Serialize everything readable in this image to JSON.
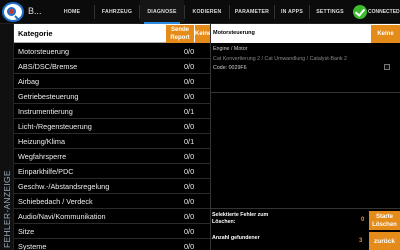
{
  "app": {
    "name": "B..."
  },
  "nav": {
    "items": [
      "HOME",
      "FAHRZEUG",
      "DIAGNOSE",
      "KODIEREN",
      "PARAMETER",
      "IN APPS",
      "SETTINGS"
    ],
    "status_label": "CONNECTED",
    "status_color": "#3dbb2e",
    "active_tab": "DIAGNOSE"
  },
  "side": {
    "label": "FEHLER-ANZEIGE"
  },
  "categories": {
    "header": "Kategorie",
    "send_report_label": "Sende Report",
    "none_label": "Keine",
    "rows": [
      {
        "label": "Motorsteuerung",
        "count": "0/0"
      },
      {
        "label": "ABS/DSC/Bremse",
        "count": "0/0"
      },
      {
        "label": "Airbag",
        "count": "0/0"
      },
      {
        "label": "Getriebesteuerung",
        "count": "0/0"
      },
      {
        "label": "Instrumentierung",
        "count": "0/1"
      },
      {
        "label": "Licht-/Regensteuerung",
        "count": "0/0"
      },
      {
        "label": "Heizung/Klima",
        "count": "0/1"
      },
      {
        "label": "Wegfahrsperre",
        "count": "0/0"
      },
      {
        "label": "Einparkhilfe/PDC",
        "count": "0/0"
      },
      {
        "label": "Geschw.-/Abstandsregelung",
        "count": "0/0"
      },
      {
        "label": "Schiebedach / Verdeck",
        "count": "0/0"
      },
      {
        "label": "Audio/Navi/Kommunikation",
        "count": "0/0"
      },
      {
        "label": "Sitze",
        "count": "0/0"
      },
      {
        "label": "Systeme",
        "count": "0/0"
      }
    ]
  },
  "errors": {
    "header": "Motorsteuerung",
    "none_label": "Keine",
    "item": {
      "title": "Engine / Motor",
      "description": "Cat Konvertierung 2 / Cat Umwandlung / Catalyst-Bank 2",
      "code": "Code:  0029F6"
    }
  },
  "bottom": {
    "selected_label": "Selektierte Fehler zum Löschen:",
    "selected_value": "0",
    "start_delete_label": "Starte Löschen",
    "found_label": "Anzahl gefundener",
    "found_value": "3",
    "back_label": "zurück",
    "accent_color": "#e58b1a"
  }
}
